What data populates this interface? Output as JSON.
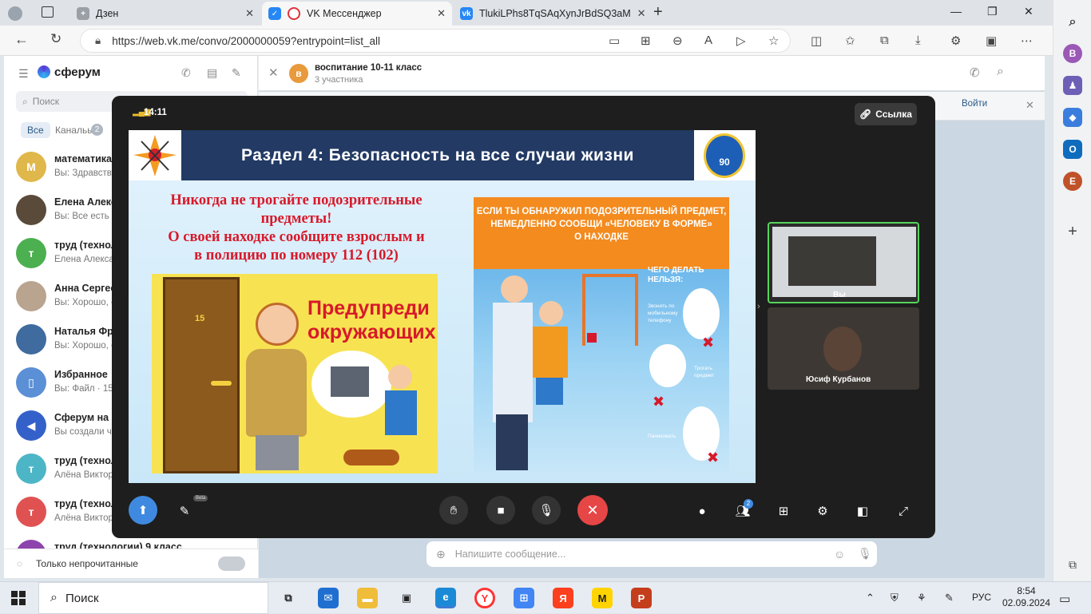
{
  "browser": {
    "tabs": [
      {
        "title": "Дзен"
      },
      {
        "title": "VK Мессенджер"
      },
      {
        "title": "TlukiLPhs8TqSAqXynJrBdSQ3aM"
      }
    ],
    "url": "https://web.vk.me/convo/2000000059?entrypoint=list_all"
  },
  "edge_sidebar": {
    "letters": [
      "B",
      "E"
    ]
  },
  "vk": {
    "logo": "сферум",
    "search_placeholder": "Поиск",
    "filters": {
      "all": "Все",
      "channels": "Канальы",
      "channels_count": "2"
    },
    "chats": [
      {
        "name": "математика",
        "msg": "Вы: Здравству",
        "avatar": "M",
        "color": "#e0b74a"
      },
      {
        "name": "Елена Алекса",
        "msg": "Вы: Все есть в",
        "avatar": "",
        "color": "#5a4a3a"
      },
      {
        "name": "труд (технол",
        "msg": "Елена Алекса",
        "avatar": "т",
        "color": "#4caf50"
      },
      {
        "name": "Анна Сергеев",
        "msg": "Вы: Хорошо, с",
        "avatar": "",
        "color": "#b9a48f"
      },
      {
        "name": "Наталья Фро",
        "msg": "Вы: Хорошо, с",
        "avatar": "",
        "color": "#3f6b9e"
      },
      {
        "name": "Избранное",
        "msg": "Вы: Файл · 154",
        "avatar": "🔖",
        "color": "#5b8fd6"
      },
      {
        "name": "Сферум на с",
        "msg": "Вы создали ч",
        "avatar": "📣",
        "color": "#3461c9"
      },
      {
        "name": "труд (технол",
        "msg": "Алёна Виктор",
        "avatar": "т",
        "color": "#4db6c6"
      },
      {
        "name": "труд (технол",
        "msg": "Алёна Виктор",
        "avatar": "т",
        "color": "#e05252"
      },
      {
        "name": "труд (технологии) 9 класс",
        "msg": "",
        "avatar": "т",
        "color": "#8e44ad"
      }
    ],
    "unread_only": "Только непрочитанные",
    "convo_title": "воспитание 10-11 класс",
    "convo_sub": "3 участника",
    "convo_avatar": "в",
    "join_label": "Войти",
    "message_placeholder": "Напишите сообщение..."
  },
  "call": {
    "time": "14:11",
    "link_label": "Ссылка",
    "beta_label": "Beta",
    "participants_count": "2",
    "participants": [
      {
        "name": "Вы"
      },
      {
        "name": "Юсиф Курбанов"
      }
    ],
    "slide": {
      "header": "Раздел 4: Безопасность на все случаи жизни",
      "emblem_num": "90",
      "text_lines": [
        "Никогда не трогайте подозрительные",
        "предметы!",
        "О своей находке сообщите взрослым и",
        "в полицию по номеру 112 (102)"
      ],
      "poster1_text": [
        "Предупреди",
        "окружающих!"
      ],
      "door_number": "15",
      "poster2_head": [
        "ЕСЛИ ТЫ ОБНАРУЖИЛ ПОДОЗРИТЕЛЬНЫЙ ПРЕДМЕТ,",
        "НЕМЕДЛЕННО СООБЩИ «ЧЕЛОВЕКУ В ФОРМЕ»",
        "О НАХОДКЕ"
      ],
      "cannot_title": [
        "ЧЕГО ДЕЛАТЬ",
        "НЕЛЬЗЯ:"
      ],
      "item1": [
        "Звонить по",
        "мобильному",
        "телефону"
      ],
      "item2": [
        "Трогать",
        "предмет"
      ],
      "item3": "Паниковать"
    }
  },
  "taskbar": {
    "search_label": "Поиск",
    "lang": "РУС",
    "time": "8:54",
    "date": "02.09.2024"
  }
}
